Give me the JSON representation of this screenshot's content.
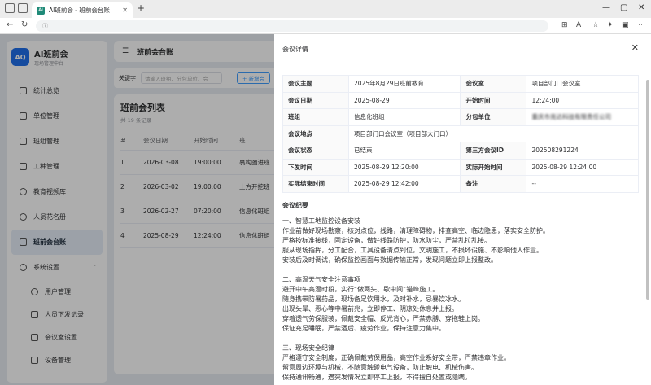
{
  "browser": {
    "tab_title": "AI班前会 - 班前会台账",
    "favicon_text": "AI",
    "url": ""
  },
  "sidebar": {
    "logo_text": "AQ",
    "brand_title": "AI班前会",
    "brand_sub": "现场管理中台",
    "items": [
      {
        "label": "统计总览",
        "icon": "home-icon"
      },
      {
        "label": "单位管理",
        "icon": "building-icon"
      },
      {
        "label": "班组管理",
        "icon": "team-icon"
      },
      {
        "label": "工种管理",
        "icon": "briefcase-icon"
      },
      {
        "label": "教育视频库",
        "icon": "play-icon"
      },
      {
        "label": "人员花名册",
        "icon": "user-icon"
      },
      {
        "label": "班前会台账",
        "icon": "folder-icon",
        "active": true
      },
      {
        "label": "系统设置",
        "icon": "gear-icon",
        "arrow": "˄"
      }
    ],
    "sub_items": [
      {
        "label": "用户管理",
        "icon": "user-icon"
      },
      {
        "label": "人员下发记录",
        "icon": "upload-icon"
      },
      {
        "label": "会议室设置",
        "icon": "home-icon"
      },
      {
        "label": "设备管理",
        "icon": "monitor-icon"
      }
    ]
  },
  "main": {
    "header_title": "班前会台账",
    "search_label": "关键字",
    "search_placeholder": "请输入班组、分包单位、会",
    "add_button": "+ 新增会",
    "list_title": "班前会列表",
    "list_count": "共 19 条记录",
    "columns": [
      "#",
      "会议日期",
      "开始时间",
      "班"
    ],
    "rows": [
      [
        "1",
        "2026-03-08",
        "19:00:00",
        "裹构图进班"
      ],
      [
        "2",
        "2026-03-02",
        "19:00:00",
        "土方开挖班"
      ],
      [
        "3",
        "2026-02-27",
        "07:20:00",
        "信息化班组"
      ],
      [
        "4",
        "2025-08-29",
        "12:24:00",
        "信息化班组"
      ]
    ]
  },
  "drawer": {
    "title": "会议详情",
    "details": [
      [
        "会议主题",
        "2025年8月29日班前教育",
        "会议室",
        "项目部门口会议室"
      ],
      [
        "会议日期",
        "2025-08-29",
        "开始时间",
        "12:24:00"
      ],
      [
        "班组",
        "信息化班组",
        "分包单位",
        "重庆市亮达科技有限责任公司"
      ],
      [
        "会议地点",
        "项目部门口会议室（项目部大门口）"
      ],
      [
        "会议状态",
        "已结束",
        "第三方会议ID",
        "202508291224"
      ],
      [
        "下发时间",
        "2025-08-29 12:20:00",
        "实际开始时间",
        "2025-08-29 12:24:00"
      ],
      [
        "实际结束时间",
        "2025-08-29 12:42:00",
        "备注",
        "--"
      ]
    ],
    "minutes_title": "会议纪要",
    "minutes": "一、智慧工地监控设备安装\n作业前做好现场勘察，核对点位，线路，清理障碍物，排查高空、临边隐患，落实安全防护。\n严格按标准接线，固定设备，做好线路防护，防水防尘，严禁乱拉乱接。\n服从现场指挥，分工配合，工具设备清点到位，文明施工，不损坏设施、不影响他人作业。\n安装后及时调试，确保监控画面与数据传输正常，发现问题立即上报整改。\n\n二、高温天气安全注意事项\n避开中午高温时段，实行“做两头、歇中间”错峰施工。\n随身携带防暑药品，现场备足饮用水，及时补水，忌暴饮冰水。\n出现头晕、恶心等中暑前兆，立即停工、阴凉处休息并上报。\n穿着透气劳保服装，佩戴安全帽、反光背心，严禁赤膊、穿拖鞋上岗。\n保证充足睡眠，严禁酒后、疲劳作业，保持注意力集中。\n\n三、现场安全纪律\n严格遵守安全制度，正确佩戴劳保用品，高空作业系好安全带，严禁违章作业。\n留意周边环境与机械，不随意触碰电气设备，防止触电、机械伤害。\n保持通讯畅通，遇突发情况立即停工上报，不得擅自处置或隐瞒。"
  }
}
